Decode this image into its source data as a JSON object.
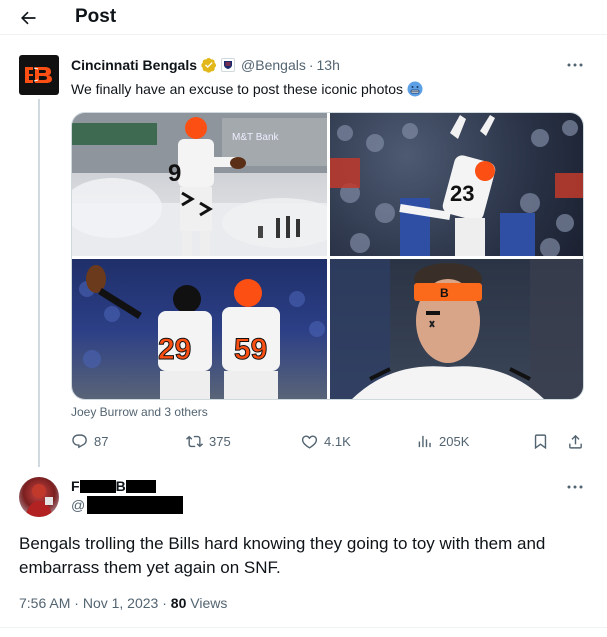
{
  "header": {
    "title": "Post"
  },
  "original_tweet": {
    "display_name": "Cincinnati Bengals",
    "handle": "@Bengals",
    "separator": "·",
    "time": "13h",
    "text": "We finally have an excuse to post these iconic photos",
    "tagged": "Joey Burrow and 3 others",
    "photos": [
      {
        "banner": "M&T Bank",
        "jersey": "9"
      },
      {
        "jersey": "23"
      },
      {
        "jerseys": [
          "29",
          "59"
        ]
      },
      {
        "headband": "B"
      }
    ],
    "stats": {
      "replies": "87",
      "reposts": "375",
      "likes": "4.1K",
      "views": "205K"
    }
  },
  "reply": {
    "name_visible_initials": "F",
    "name_visible_mid": "B",
    "handle_prefix": "@",
    "text": "Bengals trolling the Bills hard knowing they going to toy with them and embarrass them yet again on SNF.",
    "time": "7:56 AM",
    "separator": "·",
    "date": "Nov 1, 2023",
    "views_count": "80",
    "views_label": "Views"
  },
  "icons": [
    "back-arrow-icon",
    "verified-badge-icon",
    "affiliate-badge-icon",
    "more-icon",
    "reply-icon",
    "repost-icon",
    "like-icon",
    "views-icon",
    "bookmark-icon",
    "share-icon",
    "person-icon"
  ],
  "colors": {
    "text": "#0f1419",
    "muted": "#536471",
    "verified_gold": "#e2b719",
    "bengals_orange": "#fb4f14"
  }
}
